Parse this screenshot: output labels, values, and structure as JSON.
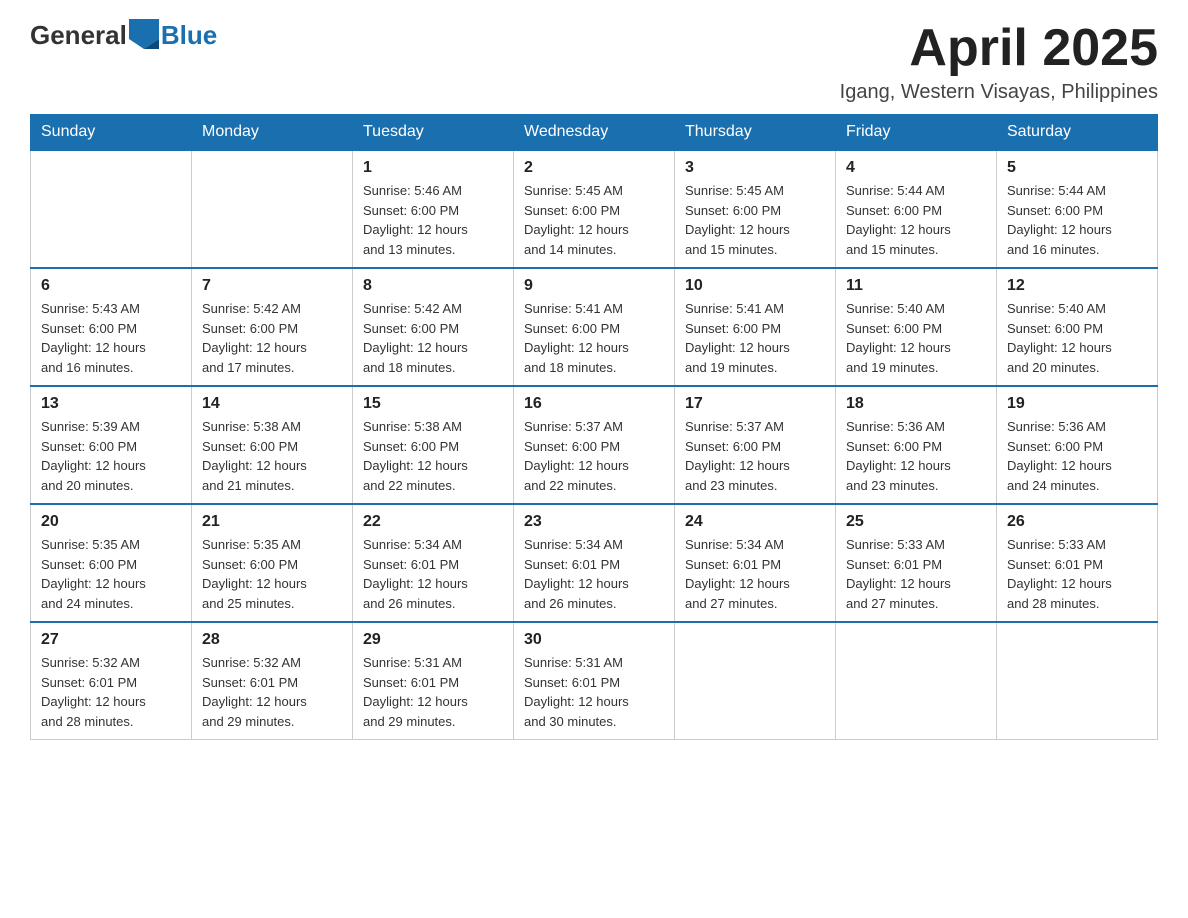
{
  "header": {
    "logo_general": "General",
    "logo_blue": "Blue",
    "month_title": "April 2025",
    "location": "Igang, Western Visayas, Philippines"
  },
  "columns": [
    "Sunday",
    "Monday",
    "Tuesday",
    "Wednesday",
    "Thursday",
    "Friday",
    "Saturday"
  ],
  "weeks": [
    [
      {
        "day": "",
        "info": ""
      },
      {
        "day": "",
        "info": ""
      },
      {
        "day": "1",
        "info": "Sunrise: 5:46 AM\nSunset: 6:00 PM\nDaylight: 12 hours\nand 13 minutes."
      },
      {
        "day": "2",
        "info": "Sunrise: 5:45 AM\nSunset: 6:00 PM\nDaylight: 12 hours\nand 14 minutes."
      },
      {
        "day": "3",
        "info": "Sunrise: 5:45 AM\nSunset: 6:00 PM\nDaylight: 12 hours\nand 15 minutes."
      },
      {
        "day": "4",
        "info": "Sunrise: 5:44 AM\nSunset: 6:00 PM\nDaylight: 12 hours\nand 15 minutes."
      },
      {
        "day": "5",
        "info": "Sunrise: 5:44 AM\nSunset: 6:00 PM\nDaylight: 12 hours\nand 16 minutes."
      }
    ],
    [
      {
        "day": "6",
        "info": "Sunrise: 5:43 AM\nSunset: 6:00 PM\nDaylight: 12 hours\nand 16 minutes."
      },
      {
        "day": "7",
        "info": "Sunrise: 5:42 AM\nSunset: 6:00 PM\nDaylight: 12 hours\nand 17 minutes."
      },
      {
        "day": "8",
        "info": "Sunrise: 5:42 AM\nSunset: 6:00 PM\nDaylight: 12 hours\nand 18 minutes."
      },
      {
        "day": "9",
        "info": "Sunrise: 5:41 AM\nSunset: 6:00 PM\nDaylight: 12 hours\nand 18 minutes."
      },
      {
        "day": "10",
        "info": "Sunrise: 5:41 AM\nSunset: 6:00 PM\nDaylight: 12 hours\nand 19 minutes."
      },
      {
        "day": "11",
        "info": "Sunrise: 5:40 AM\nSunset: 6:00 PM\nDaylight: 12 hours\nand 19 minutes."
      },
      {
        "day": "12",
        "info": "Sunrise: 5:40 AM\nSunset: 6:00 PM\nDaylight: 12 hours\nand 20 minutes."
      }
    ],
    [
      {
        "day": "13",
        "info": "Sunrise: 5:39 AM\nSunset: 6:00 PM\nDaylight: 12 hours\nand 20 minutes."
      },
      {
        "day": "14",
        "info": "Sunrise: 5:38 AM\nSunset: 6:00 PM\nDaylight: 12 hours\nand 21 minutes."
      },
      {
        "day": "15",
        "info": "Sunrise: 5:38 AM\nSunset: 6:00 PM\nDaylight: 12 hours\nand 22 minutes."
      },
      {
        "day": "16",
        "info": "Sunrise: 5:37 AM\nSunset: 6:00 PM\nDaylight: 12 hours\nand 22 minutes."
      },
      {
        "day": "17",
        "info": "Sunrise: 5:37 AM\nSunset: 6:00 PM\nDaylight: 12 hours\nand 23 minutes."
      },
      {
        "day": "18",
        "info": "Sunrise: 5:36 AM\nSunset: 6:00 PM\nDaylight: 12 hours\nand 23 minutes."
      },
      {
        "day": "19",
        "info": "Sunrise: 5:36 AM\nSunset: 6:00 PM\nDaylight: 12 hours\nand 24 minutes."
      }
    ],
    [
      {
        "day": "20",
        "info": "Sunrise: 5:35 AM\nSunset: 6:00 PM\nDaylight: 12 hours\nand 24 minutes."
      },
      {
        "day": "21",
        "info": "Sunrise: 5:35 AM\nSunset: 6:00 PM\nDaylight: 12 hours\nand 25 minutes."
      },
      {
        "day": "22",
        "info": "Sunrise: 5:34 AM\nSunset: 6:01 PM\nDaylight: 12 hours\nand 26 minutes."
      },
      {
        "day": "23",
        "info": "Sunrise: 5:34 AM\nSunset: 6:01 PM\nDaylight: 12 hours\nand 26 minutes."
      },
      {
        "day": "24",
        "info": "Sunrise: 5:34 AM\nSunset: 6:01 PM\nDaylight: 12 hours\nand 27 minutes."
      },
      {
        "day": "25",
        "info": "Sunrise: 5:33 AM\nSunset: 6:01 PM\nDaylight: 12 hours\nand 27 minutes."
      },
      {
        "day": "26",
        "info": "Sunrise: 5:33 AM\nSunset: 6:01 PM\nDaylight: 12 hours\nand 28 minutes."
      }
    ],
    [
      {
        "day": "27",
        "info": "Sunrise: 5:32 AM\nSunset: 6:01 PM\nDaylight: 12 hours\nand 28 minutes."
      },
      {
        "day": "28",
        "info": "Sunrise: 5:32 AM\nSunset: 6:01 PM\nDaylight: 12 hours\nand 29 minutes."
      },
      {
        "day": "29",
        "info": "Sunrise: 5:31 AM\nSunset: 6:01 PM\nDaylight: 12 hours\nand 29 minutes."
      },
      {
        "day": "30",
        "info": "Sunrise: 5:31 AM\nSunset: 6:01 PM\nDaylight: 12 hours\nand 30 minutes."
      },
      {
        "day": "",
        "info": ""
      },
      {
        "day": "",
        "info": ""
      },
      {
        "day": "",
        "info": ""
      }
    ]
  ]
}
